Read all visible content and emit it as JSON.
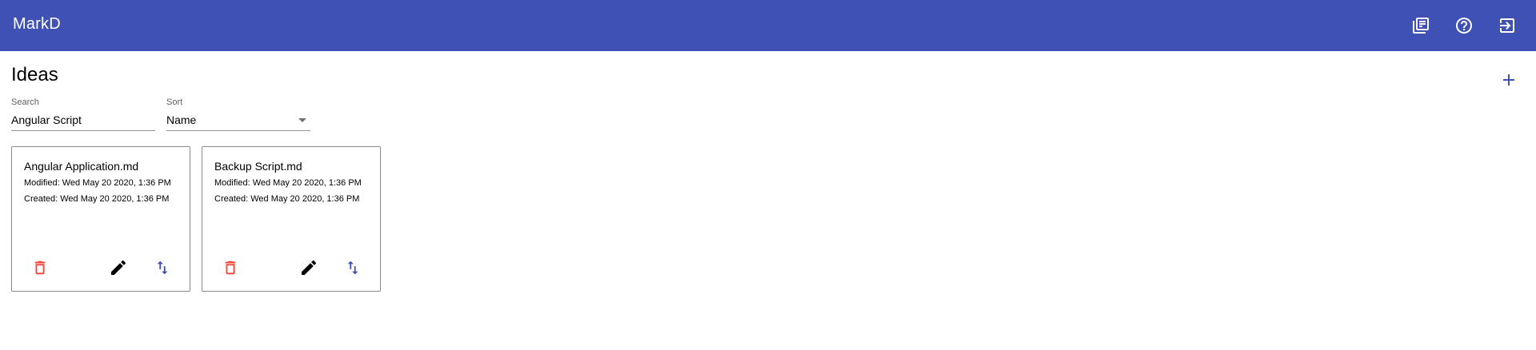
{
  "toolbar": {
    "title": "MarkD",
    "icons": [
      "library-icon",
      "help-icon",
      "logout-icon"
    ],
    "color": "#3f51b5"
  },
  "page": {
    "title": "Ideas",
    "add_icon": "add-icon"
  },
  "search": {
    "label": "Search",
    "value": "Angular Script"
  },
  "sort": {
    "label": "Sort",
    "value": "Name"
  },
  "cards": [
    {
      "title": "Angular Application.md",
      "modified": "Modified: Wed May 20 2020, 1:36 PM",
      "created": "Created: Wed May 20 2020, 1:36 PM"
    },
    {
      "title": "Backup Script.md",
      "modified": "Modified: Wed May 20 2020, 1:36 PM",
      "created": "Created: Wed May 20 2020, 1:36 PM"
    }
  ],
  "colors": {
    "primary": "#3f51b5",
    "delete": "#f44336"
  }
}
